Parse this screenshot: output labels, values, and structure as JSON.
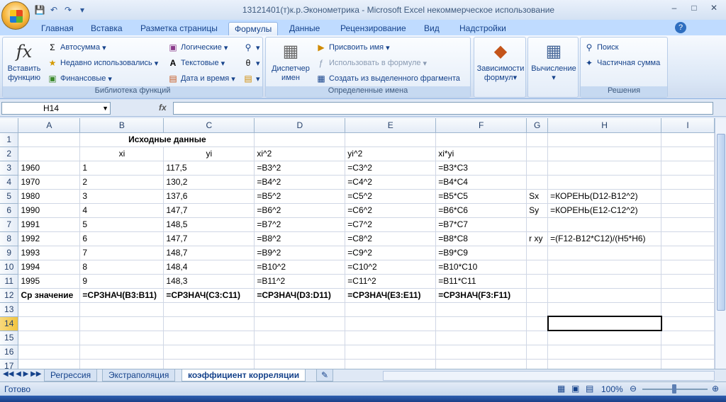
{
  "window": {
    "title": "13121401(т)к.р.Эконометрика - Microsoft Excel некоммерческое использование",
    "min_label": "–",
    "max_label": "□",
    "close_label": "✕"
  },
  "tabs": [
    "Главная",
    "Вставка",
    "Разметка страницы",
    "Формулы",
    "Данные",
    "Рецензирование",
    "Вид",
    "Надстройки"
  ],
  "active_tab": "Формулы",
  "ribbon": {
    "insert_function_line1": "Вставить",
    "insert_function_line2": "функцию",
    "autosum": "Автосумма",
    "recent": "Недавно использовались",
    "financial": "Финансовые",
    "logical": "Логические",
    "text": "Текстовые",
    "datetime": "Дата и время",
    "group_library": "Библиотека функций",
    "name_manager_line1": "Диспетчер",
    "name_manager_line2": "имен",
    "assign_name": "Присвоить имя",
    "use_in_formula": "Использовать в формуле",
    "create_from_selection": "Создать из выделенного фрагмента",
    "group_names": "Определенные имена",
    "dependencies_line1": "Зависимости",
    "dependencies_line2": "формул",
    "calculation": "Вычисление",
    "search": "Поиск",
    "partial_sum": "Частичная сумма",
    "group_solutions": "Решения"
  },
  "formula_bar": {
    "name_box": "H14",
    "fx": "fx",
    "formula": ""
  },
  "columns": [
    "A",
    "B",
    "C",
    "D",
    "E",
    "F",
    "G",
    "H",
    "I"
  ],
  "rows": [
    [
      "",
      "Исходные данные",
      "",
      "",
      "",
      "",
      "",
      ""
    ],
    [
      "",
      "xi",
      "yi",
      "xi^2",
      "yi^2",
      "xi*yi",
      "",
      ""
    ],
    [
      "1960",
      "1",
      "117,5",
      "=B3^2",
      "=C3^2",
      "=B3*C3",
      "",
      ""
    ],
    [
      "1970",
      "2",
      "130,2",
      "=B4^2",
      "=C4^2",
      "=B4*C4",
      "",
      ""
    ],
    [
      "1980",
      "3",
      "137,6",
      "=B5^2",
      "=C5^2",
      "=B5*C5",
      "Sx",
      "=КОРЕНЬ(D12-B12^2)"
    ],
    [
      "1990",
      "4",
      "147,7",
      "=B6^2",
      "=C6^2",
      "=B6*C6",
      "Sy",
      "=КОРЕНЬ(E12-C12^2)"
    ],
    [
      "1991",
      "5",
      "148,5",
      "=B7^2",
      "=C7^2",
      "=B7*C7",
      "",
      ""
    ],
    [
      "1992",
      "6",
      "147,7",
      "=B8^2",
      "=C8^2",
      "=B8*C8",
      "r xy",
      "=(F12-B12*C12)/(H5*H6)"
    ],
    [
      "1993",
      "7",
      "148,7",
      "=B9^2",
      "=C9^2",
      "=B9*C9",
      "",
      ""
    ],
    [
      "1994",
      "8",
      "148,4",
      "=B10^2",
      "=C10^2",
      "=B10*C10",
      "",
      ""
    ],
    [
      "1995",
      "9",
      "148,3",
      "=B11^2",
      "=C11^2",
      "=B11*C11",
      "",
      ""
    ],
    [
      "Ср значение",
      "=СРЗНАЧ(B3:B11)",
      "=СРЗНАЧ(C3:C11)",
      "=СРЗНАЧ(D3:D11)",
      "=СРЗНАЧ(E3:E11)",
      "=СРЗНАЧ(F3:F11)",
      "",
      ""
    ],
    [
      "",
      "",
      "",
      "",
      "",
      "",
      "",
      ""
    ],
    [
      "",
      "",
      "",
      "",
      "",
      "",
      "",
      ""
    ],
    [
      "",
      "",
      "",
      "",
      "",
      "",
      "",
      ""
    ],
    [
      "",
      "",
      "",
      "",
      "",
      "",
      "",
      ""
    ],
    [
      "",
      "",
      "",
      "",
      "",
      "",
      "",
      ""
    ]
  ],
  "row_numbers": [
    "1",
    "2",
    "3",
    "4",
    "5",
    "6",
    "7",
    "8",
    "9",
    "10",
    "11",
    "12",
    "13",
    "14",
    "15",
    "16",
    "17"
  ],
  "sheets": [
    "Регрессия",
    "Экстраполяция",
    "коэффициент корреляции"
  ],
  "active_sheet": "коэффициент корреляции",
  "status": {
    "ready": "Готово",
    "zoom": "100%"
  },
  "colors": {
    "accent": "#15428b",
    "ribbon_bg": "#dbe7f6",
    "selected_header": "#f1c43f"
  }
}
